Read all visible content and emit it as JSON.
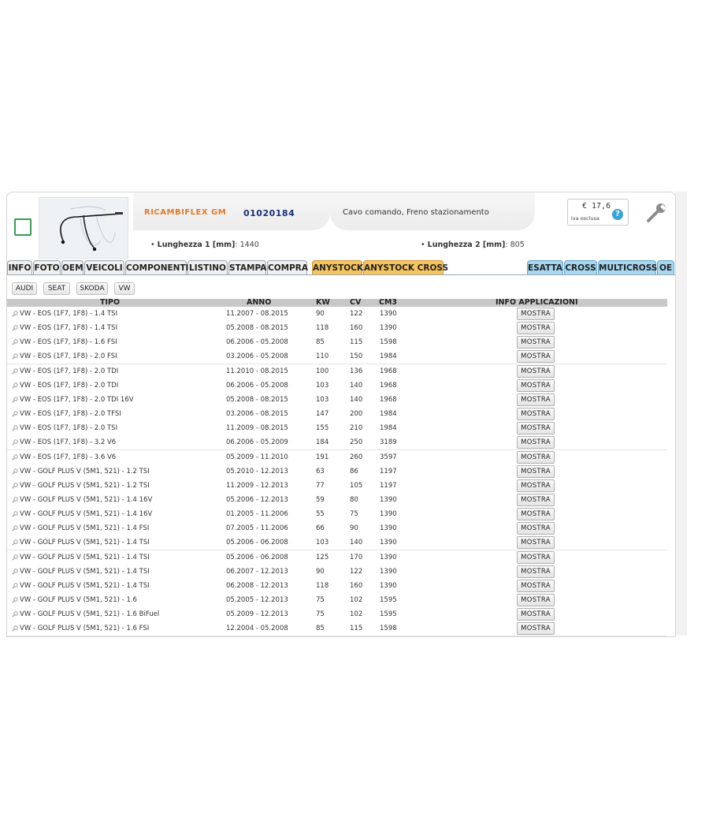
{
  "product": {
    "brand": "RICAMBIFLEX GM",
    "code": "01020184",
    "description": "Cavo comando, Freno stazionamento",
    "price": "€ 17,6",
    "vat_note": "iva esclusa",
    "help_glyph": "?",
    "spec1_label": "Lunghezza 1 [mm]",
    "spec1_value": ": 1440",
    "spec2_label": "Lunghezza 2 [mm]",
    "spec2_value": ": 805",
    "bullet": "•"
  },
  "tabs": [
    "INFO",
    "FOTO",
    "OEM",
    "VEICOLI",
    "COMPONENTI",
    "LISTINO",
    "STAMPA",
    "COMPRA",
    "ANYSTOCK",
    "ANYSTOCK CROSS",
    "ESATTA",
    "CROSS",
    "MULTICROSS",
    "OE"
  ],
  "filters": [
    "AUDI",
    "SEAT",
    "SKODA",
    "VW"
  ],
  "table": {
    "headers": [
      "TIPO",
      "ANNO",
      "KW",
      "CV",
      "CM3",
      "INFO APPLICAZIONI"
    ],
    "button_label": "MOSTRA",
    "rows": [
      {
        "tipo": "VW - EOS (1F7, 1F8) - 1.4 TSI",
        "anno": "11.2007 - 08.2015",
        "kw": "90",
        "cv": "122",
        "cm3": "1390"
      },
      {
        "tipo": "VW - EOS (1F7, 1F8) - 1.4 TSI",
        "anno": "05.2008 - 08.2015",
        "kw": "118",
        "cv": "160",
        "cm3": "1390"
      },
      {
        "tipo": "VW - EOS (1F7, 1F8) - 1.6 FSI",
        "anno": "06.2006 - 05.2008",
        "kw": "85",
        "cv": "115",
        "cm3": "1598"
      },
      {
        "tipo": "VW - EOS (1F7, 1F8) - 2.0 FSI",
        "anno": "03.2006 - 05.2008",
        "kw": "110",
        "cv": "150",
        "cm3": "1984"
      },
      {
        "tipo": "VW - EOS (1F7, 1F8) - 2.0 TDI",
        "anno": "11.2010 - 08.2015",
        "kw": "100",
        "cv": "136",
        "cm3": "1968"
      },
      {
        "tipo": "VW - EOS (1F7, 1F8) - 2.0 TDI",
        "anno": "06.2006 - 05.2008",
        "kw": "103",
        "cv": "140",
        "cm3": "1968"
      },
      {
        "tipo": "VW - EOS (1F7, 1F8) - 2.0 TDI 16V",
        "anno": "05.2008 - 08.2015",
        "kw": "103",
        "cv": "140",
        "cm3": "1968"
      },
      {
        "tipo": "VW - EOS (1F7, 1F8) - 2.0 TFSI",
        "anno": "03.2006 - 08.2015",
        "kw": "147",
        "cv": "200",
        "cm3": "1984"
      },
      {
        "tipo": "VW - EOS (1F7, 1F8) - 2.0 TSI",
        "anno": "11.2009 - 08.2015",
        "kw": "155",
        "cv": "210",
        "cm3": "1984"
      },
      {
        "tipo": "VW - EOS (1F7, 1F8) - 3.2 V6",
        "anno": "06.2006 - 05.2009",
        "kw": "184",
        "cv": "250",
        "cm3": "3189"
      },
      {
        "tipo": "VW - EOS (1F7, 1F8) - 3.6 V6",
        "anno": "05.2009 - 11.2010",
        "kw": "191",
        "cv": "260",
        "cm3": "3597"
      },
      {
        "tipo": "VW - GOLF PLUS V (5M1, 521) - 1.2 TSI",
        "anno": "05.2010 - 12.2013",
        "kw": "63",
        "cv": "86",
        "cm3": "1197"
      },
      {
        "tipo": "VW - GOLF PLUS V (5M1, 521) - 1.2 TSI",
        "anno": "11.2009 - 12.2013",
        "kw": "77",
        "cv": "105",
        "cm3": "1197"
      },
      {
        "tipo": "VW - GOLF PLUS V (5M1, 521) - 1.4 16V",
        "anno": "05.2006 - 12.2013",
        "kw": "59",
        "cv": "80",
        "cm3": "1390"
      },
      {
        "tipo": "VW - GOLF PLUS V (5M1, 521) - 1.4 16V",
        "anno": "01.2005 - 11.2006",
        "kw": "55",
        "cv": "75",
        "cm3": "1390"
      },
      {
        "tipo": "VW - GOLF PLUS V (5M1, 521) - 1.4 FSI",
        "anno": "07.2005 - 11.2006",
        "kw": "66",
        "cv": "90",
        "cm3": "1390"
      },
      {
        "tipo": "VW - GOLF PLUS V (5M1, 521) - 1.4 TSI",
        "anno": "05.2006 - 06.2008",
        "kw": "103",
        "cv": "140",
        "cm3": "1390"
      },
      {
        "tipo": "VW - GOLF PLUS V (5M1, 521) - 1.4 TSI",
        "anno": "05.2006 - 06.2008",
        "kw": "125",
        "cv": "170",
        "cm3": "1390"
      },
      {
        "tipo": "VW - GOLF PLUS V (5M1, 521) - 1.4 TSI",
        "anno": "06.2007 - 12.2013",
        "kw": "90",
        "cv": "122",
        "cm3": "1390"
      },
      {
        "tipo": "VW - GOLF PLUS V (5M1, 521) - 1.4 TSI",
        "anno": "06.2008 - 12.2013",
        "kw": "118",
        "cv": "160",
        "cm3": "1390"
      },
      {
        "tipo": "VW - GOLF PLUS V (5M1, 521) - 1.6",
        "anno": "05.2005 - 12.2013",
        "kw": "75",
        "cv": "102",
        "cm3": "1595"
      },
      {
        "tipo": "VW - GOLF PLUS V (5M1, 521) - 1.6 BiFuel",
        "anno": "05.2009 - 12.2013",
        "kw": "75",
        "cv": "102",
        "cm3": "1595"
      },
      {
        "tipo": "VW - GOLF PLUS V (5M1, 521) - 1.6 FSI",
        "anno": "12.2004 - 05.2008",
        "kw": "85",
        "cv": "115",
        "cm3": "1598"
      }
    ]
  },
  "colors": {
    "brand": "#e07a2c",
    "code": "#1c2f7a",
    "tab_orange": "#f6c45c",
    "tab_blue": "#a6d6f0",
    "checkbox_border": "#3a9a56",
    "header_bar": "#c8c8c8"
  },
  "icons": {
    "row_icon": "magnifier-icon",
    "tool_icon": "wrench-icon",
    "help_icon": "help-icon"
  }
}
